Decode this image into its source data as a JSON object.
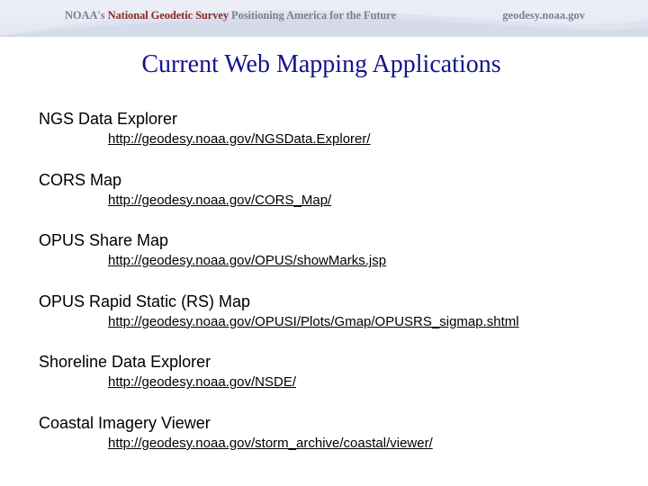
{
  "banner": {
    "org": "NOAA's",
    "name": "National Geodetic Survey",
    "tagline": "Positioning America for the Future",
    "site": "geodesy.noaa.gov"
  },
  "title": "Current Web Mapping Applications",
  "apps": [
    {
      "name": "NGS Data Explorer",
      "url": "http://geodesy.noaa.gov/NGSData.Explorer/"
    },
    {
      "name": "CORS Map",
      "url": "http://geodesy.noaa.gov/CORS_Map/"
    },
    {
      "name": "OPUS Share Map",
      "url": "http://geodesy.noaa.gov/OPUS/showMarks.jsp"
    },
    {
      "name": "OPUS Rapid Static (RS) Map",
      "url": "http://geodesy.noaa.gov/OPUSI/Plots/Gmap/OPUSRS_sigmap.shtml"
    },
    {
      "name": "Shoreline Data Explorer",
      "url": "http://geodesy.noaa.gov/NSDE/"
    },
    {
      "name": "Coastal Imagery Viewer",
      "url": "http://geodesy.noaa.gov/storm_archive/coastal/viewer/"
    }
  ]
}
